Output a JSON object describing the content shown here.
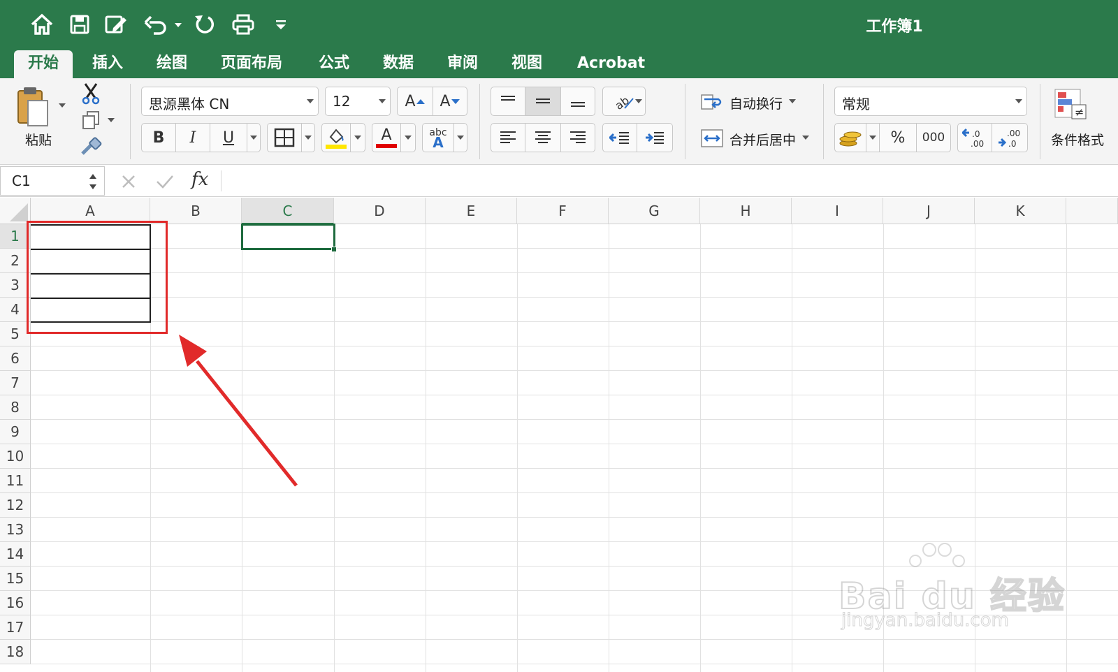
{
  "window": {
    "title": "工作簿1"
  },
  "tabs": [
    {
      "label": "开始",
      "active": true
    },
    {
      "label": "插入"
    },
    {
      "label": "绘图"
    },
    {
      "label": "页面布局"
    },
    {
      "label": "公式"
    },
    {
      "label": "数据"
    },
    {
      "label": "审阅"
    },
    {
      "label": "视图"
    },
    {
      "label": "Acrobat"
    }
  ],
  "ribbon": {
    "paste_label": "粘贴",
    "font_name": "思源黑体 CN",
    "font_size": "12",
    "bold": "B",
    "italic": "I",
    "underline": "U",
    "grow_font": "A",
    "shrink_font": "A",
    "font_color_glyph": "A",
    "abc": "abc",
    "wrap_text": "自动换行",
    "merge_center": "合并后居中",
    "number_format": "常规",
    "percent": "%",
    "thousands": "000",
    "conditional_format": "条件格式",
    "accent_color": "#2b7a4b",
    "highlight_color": "#ffe600",
    "font_color": "#e00000"
  },
  "formula_bar": {
    "name_box": "C1",
    "fx": "fx",
    "value": ""
  },
  "grid": {
    "columns": [
      "A",
      "B",
      "C",
      "D",
      "E",
      "F",
      "G",
      "H",
      "I",
      "J",
      "K"
    ],
    "rows": [
      "1",
      "2",
      "3",
      "4",
      "5",
      "6",
      "7",
      "8",
      "9",
      "10",
      "11",
      "12",
      "13",
      "14",
      "15",
      "16",
      "17",
      "18"
    ],
    "active_cell": "C1"
  },
  "watermark": {
    "brand": "Bai du 经验",
    "url": "jingyan.baidu.com"
  }
}
